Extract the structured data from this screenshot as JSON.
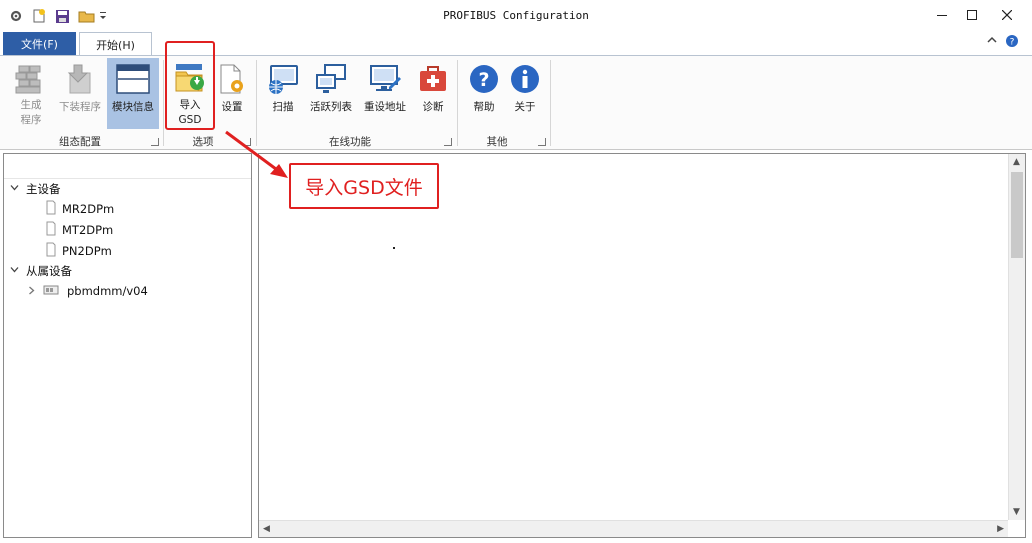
{
  "window": {
    "title": "PROFIBUS Configuration",
    "quick_access": [
      "gear-icon",
      "new-file-icon",
      "save-icon",
      "open-folder-icon",
      "dropdown-icon"
    ],
    "controls": {
      "minimize": "□",
      "restore": "□",
      "close": "✕"
    }
  },
  "ribbon": {
    "tabs": [
      {
        "label": "文件(F)",
        "active": false
      },
      {
        "label": "开始(H)",
        "active": true
      }
    ],
    "right_icons": {
      "collapse": "⌃",
      "help": "?"
    },
    "groups": [
      {
        "label": "组态配置",
        "buttons": [
          {
            "label_line1": "生成",
            "label_line2": "程序",
            "enabled": false,
            "icon": "bricks-icon"
          },
          {
            "label_line1": "下装程序",
            "label_line2": "",
            "enabled": false,
            "icon": "download-program-icon"
          },
          {
            "label_line1": "模块信息",
            "label_line2": "",
            "enabled": true,
            "selected": true,
            "icon": "module-info-icon"
          }
        ]
      },
      {
        "label": "选项",
        "buttons": [
          {
            "label_line1": "导入",
            "label_line2": "GSD",
            "enabled": true,
            "icon": "import-folder-icon"
          },
          {
            "label_line1": "设置",
            "label_line2": "",
            "enabled": true,
            "icon": "settings-file-icon"
          }
        ]
      },
      {
        "label": "在线功能",
        "buttons": [
          {
            "label_line1": "扫描",
            "label_line2": "",
            "enabled": true,
            "icon": "scan-network-icon"
          },
          {
            "label_line1": "活跃列表",
            "label_line2": "",
            "enabled": true,
            "icon": "active-list-icon"
          },
          {
            "label_line1": "重设地址",
            "label_line2": "",
            "enabled": true,
            "icon": "reset-address-icon"
          },
          {
            "label_line1": "诊断",
            "label_line2": "",
            "enabled": true,
            "icon": "diagnostic-kit-icon"
          }
        ]
      },
      {
        "label": "其他",
        "buttons": [
          {
            "label_line1": "帮助",
            "label_line2": "",
            "enabled": true,
            "icon": "help-icon"
          },
          {
            "label_line1": "关于",
            "label_line2": "",
            "enabled": true,
            "icon": "info-icon"
          }
        ]
      }
    ]
  },
  "annotation": {
    "text": "导入GSD文件",
    "color": "#e02020"
  },
  "tree": {
    "nodes": [
      {
        "label": "主设备",
        "expanded": true,
        "children": [
          "MR2DPm",
          "MT2DPm",
          "PN2DPm"
        ]
      },
      {
        "label": "从属设备",
        "expanded": true,
        "children": [
          "pbmdmm/v04"
        ]
      }
    ]
  },
  "colors": {
    "accent": "#2e5ea6",
    "selected": "#a9c2e3",
    "highlight": "#e02020"
  }
}
